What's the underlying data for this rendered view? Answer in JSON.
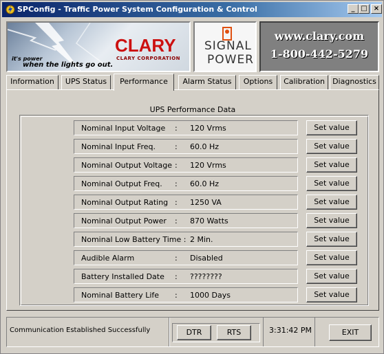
{
  "window": {
    "title": "SPConfig - Traffic Power System Configuration & Control",
    "min_glyph": "_",
    "max_glyph": "□",
    "close_glyph": "×"
  },
  "banner": {
    "clary_wordmark": "CLARY",
    "clary_corp": "CLARY CORPORATION",
    "tagline_1": "it's power",
    "tagline_2": "when the lights go out.",
    "signal_1": "SIGNAL",
    "signal_2": "POWER",
    "website": "www.clary.com",
    "phone": "1-800-442-5279"
  },
  "tabs": [
    {
      "label": "Information",
      "active": false
    },
    {
      "label": "UPS Status",
      "active": false
    },
    {
      "label": "Performance",
      "active": true
    },
    {
      "label": "Alarm Status",
      "active": false
    },
    {
      "label": "Options",
      "active": false
    },
    {
      "label": "Calibration",
      "active": false
    },
    {
      "label": "Diagnostics",
      "active": false
    }
  ],
  "performance": {
    "group_title": "UPS Performance Data",
    "set_label": "Set value",
    "rows": [
      {
        "label": "Nominal Input Voltage",
        "colon": ":",
        "value": "120  Vrms"
      },
      {
        "label": "Nominal Input Freq.",
        "colon": ":",
        "value": "60.0  Hz"
      },
      {
        "label": "Nominal Output Voltage",
        "colon": ":",
        "value": "120  Vrms"
      },
      {
        "label": "Nominal Output Freq.",
        "colon": ":",
        "value": "60.0  Hz"
      },
      {
        "label": "Nominal Output Rating",
        "colon": ":",
        "value": "1250  VA"
      },
      {
        "label": "Nominal Output Power",
        "colon": ":",
        "value": "870  Watts"
      },
      {
        "label": "Nominal Low Battery Time :",
        "colon": "",
        "value": "2  Min."
      },
      {
        "label": "Audible Alarm",
        "colon": ":",
        "value": "Disabled"
      },
      {
        "label": "Battery Installed Date",
        "colon": ":",
        "value": "????????"
      },
      {
        "label": "Nominal Battery Life",
        "colon": ":",
        "value": "1000  Days"
      }
    ]
  },
  "statusbar": {
    "message": "Communication Established Successfully",
    "dtr": "DTR",
    "rts": "RTS",
    "time": "3:31:42 PM",
    "exit": "EXIT"
  }
}
